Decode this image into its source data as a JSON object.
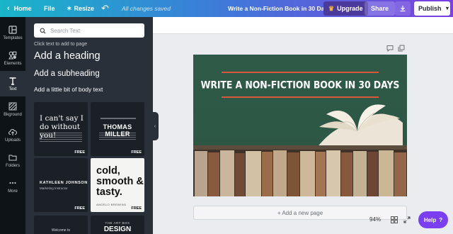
{
  "topbar": {
    "home_label": "Home",
    "file_label": "File",
    "resize_label": "Resize",
    "save_status": "All changes saved",
    "document_title": "Write a Non-Fiction Book in 30 Days",
    "upgrade_label": "Upgrade",
    "share_label": "Share",
    "publish_label": "Publish"
  },
  "rail": [
    {
      "label": "Templates",
      "icon": "templates-icon"
    },
    {
      "label": "Elements",
      "icon": "elements-icon"
    },
    {
      "label": "Text",
      "icon": "text-icon",
      "active": true
    },
    {
      "label": "Bkground",
      "icon": "background-icon"
    },
    {
      "label": "Uploads",
      "icon": "uploads-icon"
    },
    {
      "label": "Folders",
      "icon": "folder-icon"
    },
    {
      "label": "More",
      "icon": "more-icon"
    }
  ],
  "panel": {
    "search_placeholder": "Search Text",
    "hint": "Click text to add to page",
    "add_heading": "Add a heading",
    "add_subheading": "Add a subheading",
    "add_body": "Add a little bit of body text",
    "templates": [
      {
        "big": "I can't say I do without you!",
        "badge": "FREE"
      },
      {
        "big": "THOMAS MILLER",
        "badge": "FREE"
      },
      {
        "big": "KATHLEEN JOHNSON",
        "small": "Marketing Instructor",
        "badge": "FREE"
      },
      {
        "big": "cold, smooth & tasty.",
        "small": "ANGELO BREWING",
        "badge": "FREE"
      },
      {
        "small": "Welcome to"
      },
      {
        "small": "THE ART BOX",
        "big": "DESIGN"
      }
    ]
  },
  "canvas": {
    "title": "WRITE A NON-FICTION BOOK IN 30 DAYS",
    "add_page_label": "+ Add a new page"
  },
  "footer": {
    "zoom": "94%",
    "help_label": "Help",
    "help_icon_glyph": "?"
  },
  "colors": {
    "accent_rule": "#d85a3a",
    "canvas_bg": "#2f5a48",
    "help_purple": "#7a3ff0"
  }
}
